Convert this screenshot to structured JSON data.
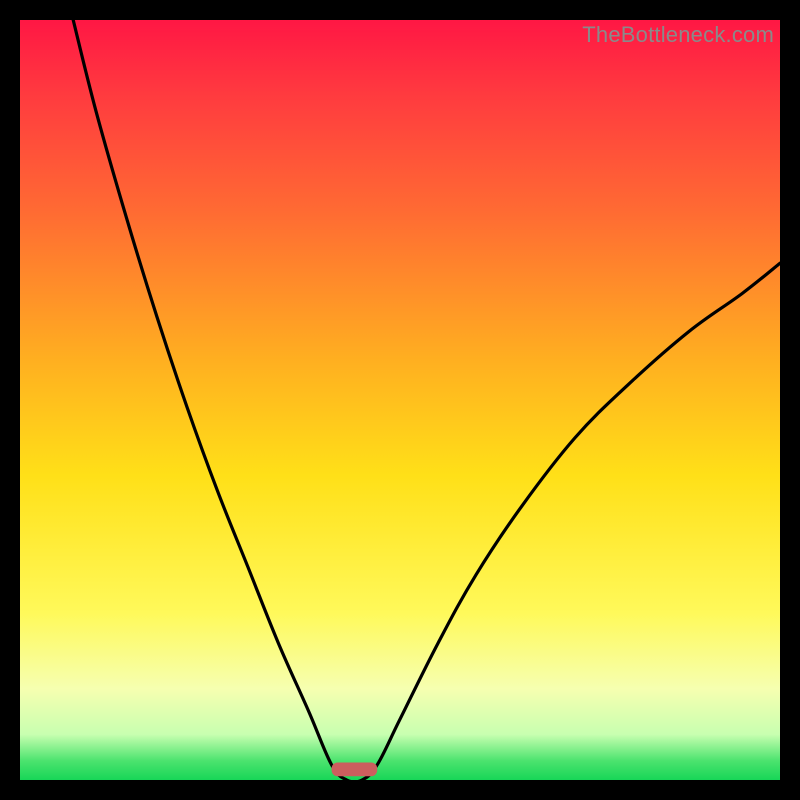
{
  "watermark": "TheBottleneck.com",
  "chart_data": {
    "type": "line",
    "title": "",
    "xlabel": "",
    "ylabel": "",
    "xlim": [
      0,
      100
    ],
    "ylim": [
      0,
      100
    ],
    "grid": false,
    "legend": false,
    "background_gradient": {
      "stops": [
        {
          "offset": 0.0,
          "color": "#ff1744"
        },
        {
          "offset": 0.1,
          "color": "#ff3b3f"
        },
        {
          "offset": 0.25,
          "color": "#ff6a33"
        },
        {
          "offset": 0.45,
          "color": "#ffb020"
        },
        {
          "offset": 0.6,
          "color": "#ffe018"
        },
        {
          "offset": 0.78,
          "color": "#fff95a"
        },
        {
          "offset": 0.88,
          "color": "#f6ffb0"
        },
        {
          "offset": 0.94,
          "color": "#c8ffb0"
        },
        {
          "offset": 0.975,
          "color": "#4be36e"
        },
        {
          "offset": 1.0,
          "color": "#17d657"
        }
      ]
    },
    "curve": {
      "description": "Black V-shaped bottleneck curve with vertex near x≈43, value≈0; left arm rises steeply to 100 at x≈7; right arm rises more gently to ≈68 at x=100.",
      "points": [
        {
          "x": 7,
          "y": 100
        },
        {
          "x": 10,
          "y": 88
        },
        {
          "x": 14,
          "y": 74
        },
        {
          "x": 18,
          "y": 61
        },
        {
          "x": 22,
          "y": 49
        },
        {
          "x": 26,
          "y": 38
        },
        {
          "x": 30,
          "y": 28
        },
        {
          "x": 34,
          "y": 18
        },
        {
          "x": 38,
          "y": 9
        },
        {
          "x": 41,
          "y": 2
        },
        {
          "x": 43,
          "y": 0
        },
        {
          "x": 45,
          "y": 0
        },
        {
          "x": 47,
          "y": 2
        },
        {
          "x": 50,
          "y": 8
        },
        {
          "x": 55,
          "y": 18
        },
        {
          "x": 60,
          "y": 27
        },
        {
          "x": 66,
          "y": 36
        },
        {
          "x": 73,
          "y": 45
        },
        {
          "x": 80,
          "y": 52
        },
        {
          "x": 88,
          "y": 59
        },
        {
          "x": 95,
          "y": 64
        },
        {
          "x": 100,
          "y": 68
        }
      ]
    },
    "marker": {
      "description": "Rounded red bar at the curve minimum",
      "x_center": 44,
      "width": 6,
      "y": 0.5,
      "height": 1.8,
      "color": "#cc5e5e"
    }
  }
}
